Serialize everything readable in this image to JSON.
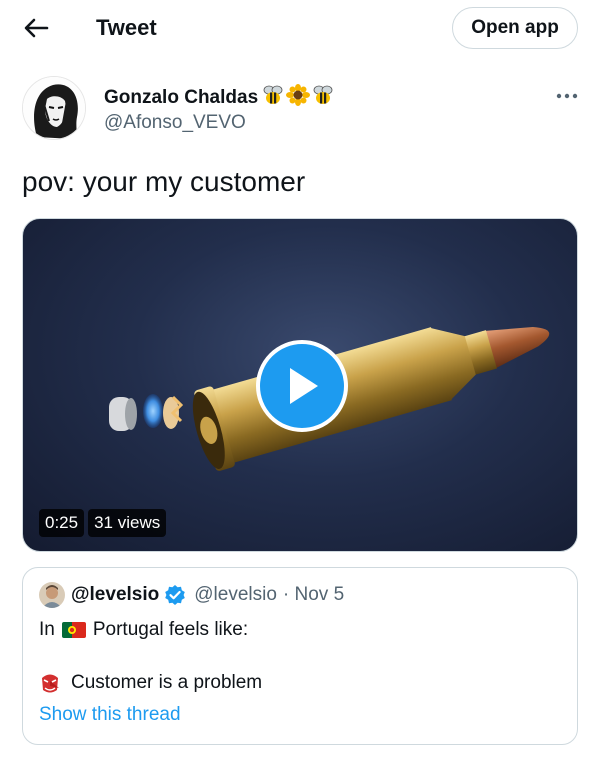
{
  "header": {
    "title": "Tweet",
    "open_app_label": "Open app"
  },
  "tweet": {
    "author_name": "Gonzalo Chaldas",
    "author_name_emojis": [
      "bee-emoji",
      "sunflower-emoji",
      "bee-emoji"
    ],
    "author_handle": "@Afonso_VEVO",
    "text": "pov: your my customer"
  },
  "video": {
    "duration": "0:25",
    "views": "31 views"
  },
  "quoted_tweet": {
    "name": "@levelsio",
    "verified": true,
    "handle": "@levelsio",
    "date": "· Nov 5",
    "line1_before": "In",
    "line1_flag": "portugal-flag-emoji",
    "line1_after": "Portugal feels like:",
    "line2_emoji": "goblin-mask-emoji",
    "line2_text": "Customer is a problem",
    "show_thread_label": "Show this thread"
  },
  "colors": {
    "accent": "#1d9bf0",
    "secondary_text": "#536471",
    "border": "#cfd9de"
  }
}
